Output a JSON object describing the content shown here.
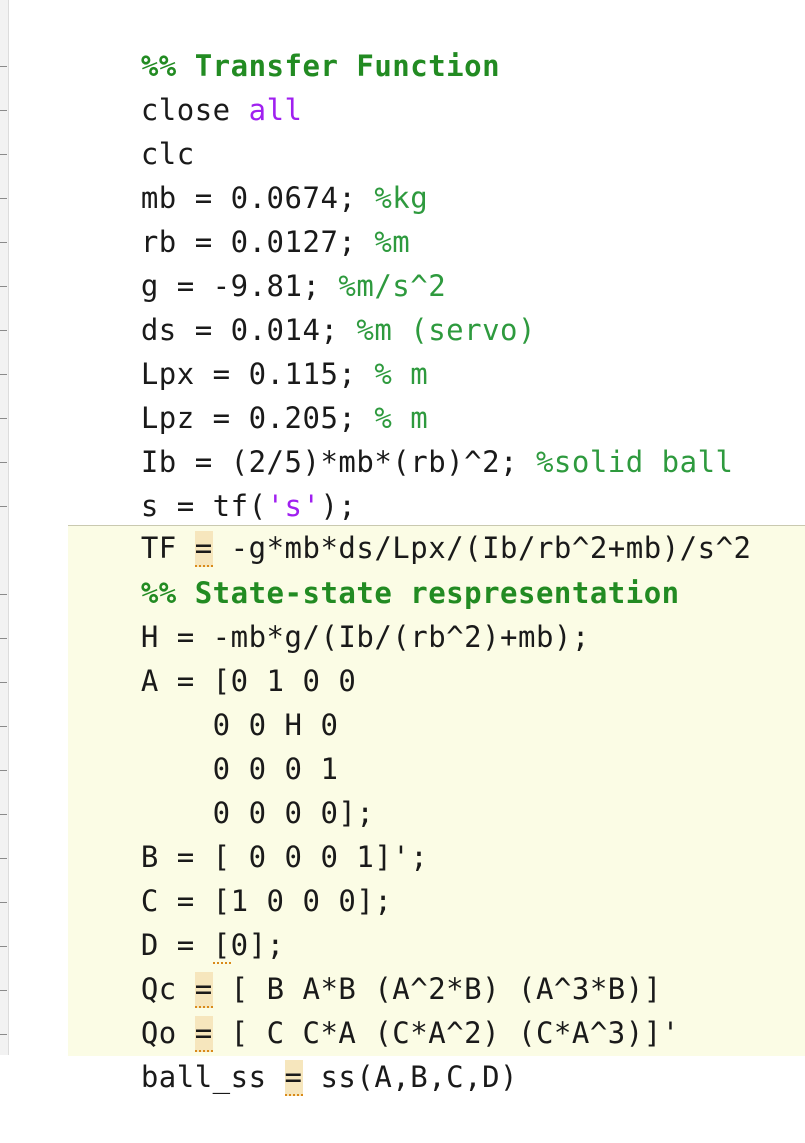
{
  "cell1": {
    "section_title": "%% Transfer Function",
    "lines": [
      {
        "code": "close ",
        "kw": "all"
      },
      {
        "code": "clc"
      },
      {
        "code": "mb = 0.0674; ",
        "comment": "%kg"
      },
      {
        "code": "rb = 0.0127; ",
        "comment": "%m"
      },
      {
        "code": "g = -9.81; ",
        "comment": "%m/s^2"
      },
      {
        "code": "ds = 0.014; ",
        "comment": "%m (servo)"
      },
      {
        "code": "Lpx = 0.115; ",
        "comment": "% m"
      },
      {
        "code": "Lpz = 0.205; ",
        "comment": "% m"
      },
      {
        "code": "Ib = (2/5)*mb*(rb)^2; ",
        "comment": "%solid ball"
      },
      {
        "code_a": "s = tf(",
        "str": "'s'",
        "code_b": ");"
      },
      {
        "code_a": "TF ",
        "warn": "=",
        "code_b": " -g*mb*ds/Lpx/(Ib/rb^2+mb)/s^2"
      }
    ]
  },
  "cell2": {
    "section_title": "%% State-state respresentation",
    "lines": [
      {
        "code": "H = -mb*g/(Ib/(rb^2)+mb);"
      },
      {
        "code": "A = [0 1 0 0"
      },
      {
        "code": "    0 0 H 0"
      },
      {
        "code": "    0 0 0 1"
      },
      {
        "code": "    0 0 0 0];"
      },
      {
        "code": "B = [ 0 0 0 1]';"
      },
      {
        "code": "C = [1 0 0 0];"
      },
      {
        "code_a": "D = ",
        "squig": "[",
        "code_b": "0];"
      },
      {
        "code_a": "Qc ",
        "warn": "=",
        "code_b": " [ B A*B (A^2*B) (A^3*B)]"
      },
      {
        "code_a": "Qo ",
        "warn": "=",
        "code_b": " [ C C*A (C*A^2) (C*A^3)]'"
      },
      {
        "code_a": "ball_ss ",
        "warn": "=",
        "code_b": " ss(A,B,C,D)"
      }
    ]
  },
  "colors": {
    "section": "#228b22",
    "comment": "#2e9a3e",
    "keyword": "#a020f0",
    "cell_highlight": "#fbfce5",
    "warning": "#d98a1a"
  }
}
